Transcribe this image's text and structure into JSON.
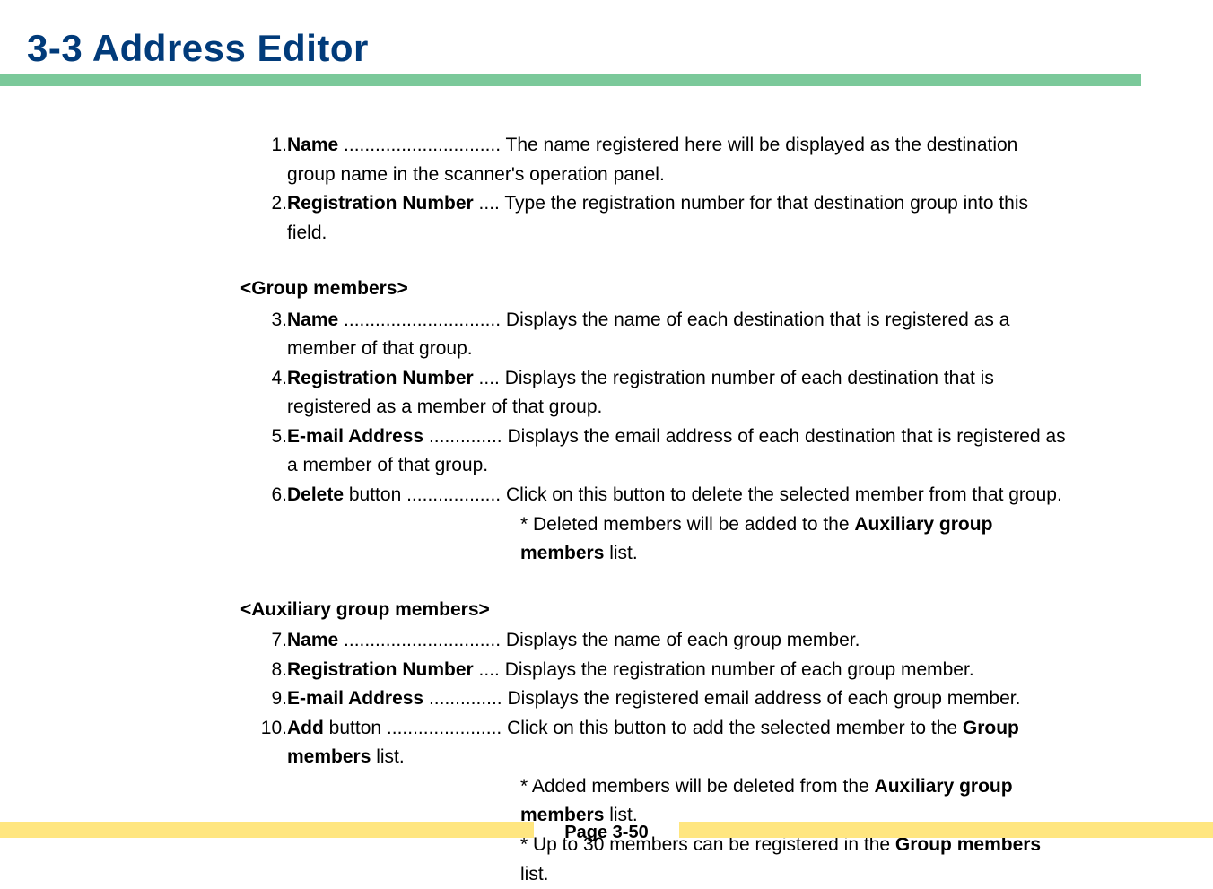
{
  "header": {
    "title": "3-3  Address Editor"
  },
  "items": {
    "i1": {
      "num": "1.",
      "label": "Name",
      "dots": " .............................. ",
      "desc": "The name registered here will be displayed as the destination group name in the scanner's operation panel."
    },
    "i2": {
      "num": "2.",
      "label": "Registration Number",
      "dots": " .... ",
      "desc": "Type the registration number for that destination group into this field."
    }
  },
  "group_heading": "<Group members>",
  "group": {
    "i3": {
      "num": "3.",
      "label": "Name",
      "dots": " .............................. ",
      "desc": "Displays the name of each destination that is registered as a member of that group."
    },
    "i4": {
      "num": "4.",
      "label": "Registration Number",
      "dots": " .... ",
      "desc": "Displays the registration number of each destination that is registered as a member of that group."
    },
    "i5": {
      "num": "5.",
      "label": "E-mail Address",
      "dots": " .............. ",
      "desc": "Displays the email address of each destination that is registered as a member of that group."
    },
    "i6": {
      "num": "6.",
      "label": "Delete",
      "label_suffix": " button",
      "dots": " .................. ",
      "desc": "Click on this button to delete the selected member from that group.",
      "note_prefix": "* Deleted members will be added to the ",
      "note_bold": "Auxiliary group members",
      "note_suffix": " list."
    }
  },
  "aux_heading": "<Auxiliary group members>",
  "aux": {
    "i7": {
      "num": "7.",
      "label": "Name",
      "dots": " .............................. ",
      "desc": "Displays the name of each group member."
    },
    "i8": {
      "num": "8.",
      "label": "Registration Number",
      "dots": " .... ",
      "desc": "Displays the registration number of each group member."
    },
    "i9": {
      "num": "9.",
      "label": "E-mail Address",
      "dots": " .............. ",
      "desc": "Displays the registered email address of each group member."
    },
    "i10": {
      "num": "10.",
      "label": "Add",
      "label_suffix": " button",
      "dots": " ...................... ",
      "desc_prefix": "Click on this button to add the selected member to the ",
      "desc_bold": "Group members",
      "desc_suffix": " list.",
      "note1_prefix": "* Added members will be deleted from the ",
      "note1_bold": "Auxiliary group members",
      "note1_suffix": " list.",
      "note2_prefix": "* Up to 30 members can be registered in the ",
      "note2_bold": "Group members",
      "note2_suffix": " list."
    }
  },
  "footer": {
    "page": "Page 3-50"
  }
}
